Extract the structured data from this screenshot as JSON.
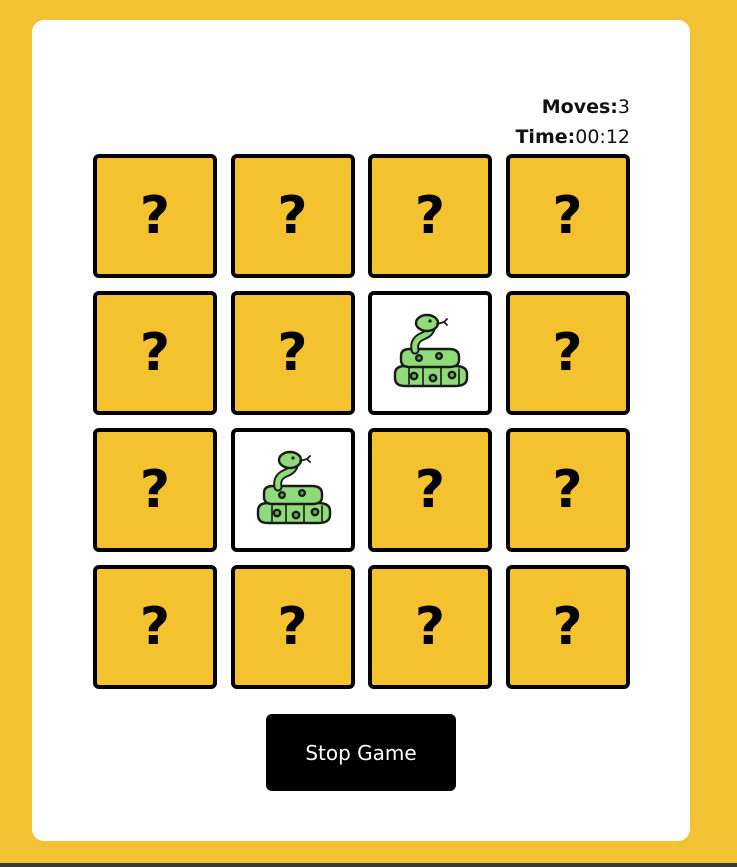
{
  "stats": {
    "moves_label": "Moves:",
    "moves_value": "3",
    "time_label": "Time:",
    "time_value": "00:12"
  },
  "board": {
    "hidden_symbol": "?",
    "cards": [
      {
        "state": "hidden"
      },
      {
        "state": "hidden"
      },
      {
        "state": "hidden"
      },
      {
        "state": "hidden"
      },
      {
        "state": "hidden"
      },
      {
        "state": "hidden"
      },
      {
        "state": "revealed",
        "icon": "snake-icon"
      },
      {
        "state": "hidden"
      },
      {
        "state": "hidden"
      },
      {
        "state": "revealed",
        "icon": "snake-icon"
      },
      {
        "state": "hidden"
      },
      {
        "state": "hidden"
      },
      {
        "state": "hidden"
      },
      {
        "state": "hidden"
      },
      {
        "state": "hidden"
      },
      {
        "state": "hidden"
      }
    ]
  },
  "controls": {
    "stop_label": "Stop Game"
  },
  "colors": {
    "background": "#f2c134",
    "card_back": "#f4c12f",
    "card_face": "#ffffff",
    "snake_green": "#8fdb7a",
    "button": "#000000"
  }
}
